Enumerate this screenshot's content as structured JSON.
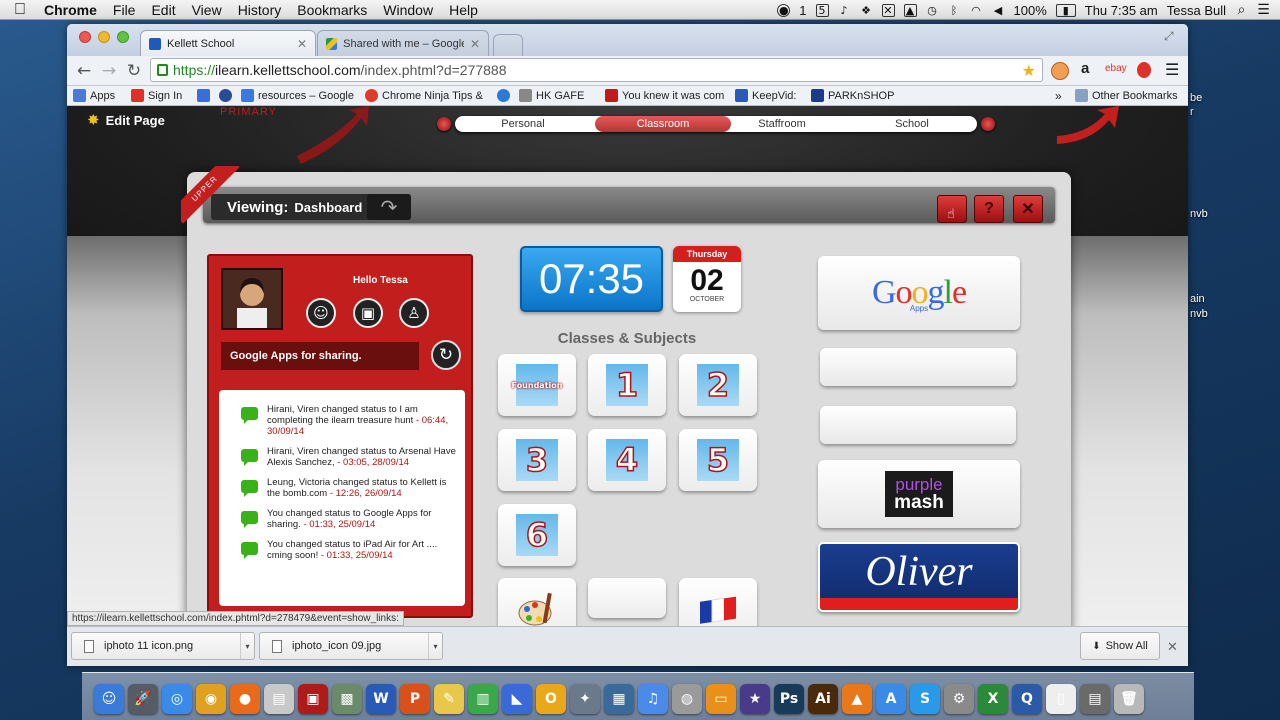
{
  "menubar": {
    "app": "Chrome",
    "items": [
      "File",
      "Edit",
      "View",
      "History",
      "Bookmarks",
      "Window",
      "Help"
    ],
    "battery": "100%",
    "clock": "Thu 7:35 am",
    "user": "Tessa Bull",
    "status_num": "1"
  },
  "desktop": {
    "labels": [
      "be",
      "r",
      "nvb",
      "ain",
      "nvb"
    ]
  },
  "tabs": [
    {
      "title": "Kellett School",
      "active": true
    },
    {
      "title": "Shared with me – Google Drive",
      "active": false
    }
  ],
  "url": {
    "scheme": "https://",
    "host": "ilearn.kellettschool.com",
    "path": "/index.phtml?d=277888"
  },
  "bookmarks": {
    "items": [
      {
        "label": "Apps",
        "color": "#4a7ad8"
      },
      {
        "label": "Sign In",
        "color": "#e0302a"
      },
      {
        "label": "",
        "color": "#3a6fd8"
      },
      {
        "label": "",
        "color": "#2a4a9a"
      },
      {
        "label": "resources – Google",
        "color": "#3a7adf"
      },
      {
        "label": "Chrome Ninja Tips &",
        "color": "#e03a2a"
      },
      {
        "label": "",
        "color": "#2a7ad8"
      },
      {
        "label": "HK GAFE",
        "color": "#888888"
      },
      {
        "label": "You knew it was com",
        "color": "#c01a1a"
      },
      {
        "label": "KeepVid:",
        "color": "#2a5ab8"
      },
      {
        "label": "PARKnSHOP",
        "color": "#1a3a8a"
      }
    ],
    "more": "»",
    "other": "Other Bookmarks"
  },
  "site": {
    "edit_page": "Edit Page",
    "primary": "PRIMARY",
    "nav": [
      "Personal",
      "Classroom",
      "Staffroom",
      "School"
    ],
    "upper": "UPPER"
  },
  "viewing": {
    "label": "Viewing:",
    "page": "Dashboard"
  },
  "panel_buttons": {
    "edit": "",
    "help": "?",
    "close": "✕"
  },
  "profile": {
    "greeting": "Hello Tessa",
    "status": "Google Apps for sharing."
  },
  "feed": [
    {
      "text": " Hirani, Viren changed status to I am completing the ilearn treasure hunt",
      "time": " - 06:44, 30/09/14"
    },
    {
      "text": " Hirani, Viren changed status to Arsenal Have Alexis Sanchez,",
      "time": " - 03:05, 28/09/14"
    },
    {
      "text": " Leung, Victoria changed status to Kellett is the bomb.com",
      "time": " - 12:26, 26/09/14"
    },
    {
      "text": " You changed status to Google Apps for sharing.",
      "time": " - 01:33, 25/09/14"
    },
    {
      "text": " You changed status to iPad Air for Art .... cming soon!",
      "time": " - 01:33, 25/09/14"
    }
  ],
  "clock": "07:35",
  "calendar": {
    "weekday": "Thursday",
    "day": "02",
    "month": "OCTOBER"
  },
  "classes": {
    "title": "Classes & Subjects",
    "tiles": [
      "Foundation",
      "1",
      "2",
      "3",
      "4",
      "5",
      "6",
      "",
      "",
      ""
    ]
  },
  "apps": {
    "google": {
      "word": "Google",
      "sub": "Apps"
    },
    "purplemash": {
      "top": "purple",
      "bottom": "mash"
    },
    "oliver": "Oliver"
  },
  "status_url": "https://ilearn.kellettschool.com/index.phtml?d=278479&event=show_links:",
  "downloads": {
    "files": [
      "iphoto 11 icon.png",
      "iphoto_icon 09.jpg"
    ],
    "show_all": "Show All"
  },
  "dock": {
    "icons": [
      {
        "name": "finder",
        "color": "#3a7ad8",
        "glyph": "☺"
      },
      {
        "name": "launchpad",
        "color": "#555c66",
        "glyph": "🚀"
      },
      {
        "name": "safari",
        "color": "#3a8ae8",
        "glyph": "◎"
      },
      {
        "name": "chrome",
        "color": "#e0a020",
        "glyph": "◉"
      },
      {
        "name": "firefox",
        "color": "#e86a1a",
        "glyph": "●"
      },
      {
        "name": "preview",
        "color": "#c8c8c8",
        "glyph": "▤"
      },
      {
        "name": "photo-booth",
        "color": "#b01a1a",
        "glyph": "▣"
      },
      {
        "name": "iphoto",
        "color": "#6a8a6a",
        "glyph": "▩"
      },
      {
        "name": "word",
        "color": "#2a5ab8",
        "glyph": "W"
      },
      {
        "name": "powerpoint",
        "color": "#d8501a",
        "glyph": "P"
      },
      {
        "name": "notes",
        "color": "#e8c84a",
        "glyph": "✎"
      },
      {
        "name": "numbers",
        "color": "#3aa84a",
        "glyph": "▥"
      },
      {
        "name": "keynote",
        "color": "#3a6ad8",
        "glyph": "◣"
      },
      {
        "name": "outlook",
        "color": "#e8a81a",
        "glyph": "O"
      },
      {
        "name": "xcode",
        "color": "#6a7a8a",
        "glyph": "✦"
      },
      {
        "name": "iphoto-2",
        "color": "#3a6a9a",
        "glyph": "▦"
      },
      {
        "name": "itunes",
        "color": "#4a8ae8",
        "glyph": "♫"
      },
      {
        "name": "system-camera",
        "color": "#9a9a9a",
        "glyph": "◍"
      },
      {
        "name": "ibooks",
        "color": "#e8901a",
        "glyph": "▭"
      },
      {
        "name": "imovie",
        "color": "#4a3a8a",
        "glyph": "★"
      },
      {
        "name": "photoshop",
        "color": "#1a3a5a",
        "glyph": "Ps"
      },
      {
        "name": "illustrator",
        "color": "#4a2a0a",
        "glyph": "Ai"
      },
      {
        "name": "vlc",
        "color": "#e8781a",
        "glyph": "▲"
      },
      {
        "name": "app-store",
        "color": "#3a8ae8",
        "glyph": "A"
      },
      {
        "name": "skype",
        "color": "#2a9ae8",
        "glyph": "S"
      },
      {
        "name": "system-preferences",
        "color": "#8a8a8a",
        "glyph": "⚙"
      },
      {
        "name": "excel",
        "color": "#2a8a3a",
        "glyph": "X"
      },
      {
        "name": "quicktime",
        "color": "#2a5aa8",
        "glyph": "Q"
      },
      {
        "name": "document",
        "color": "#eeeeee",
        "glyph": "▯"
      },
      {
        "name": "downloads-stack",
        "color": "#6a6a6a",
        "glyph": "▤"
      },
      {
        "name": "trash",
        "color": "#b8b8b8",
        "glyph": "🗑"
      }
    ]
  },
  "colors": {
    "accent_red": "#c21e1e",
    "link_green": "#1e8a1e",
    "clock_blue": "#0b74c9"
  }
}
